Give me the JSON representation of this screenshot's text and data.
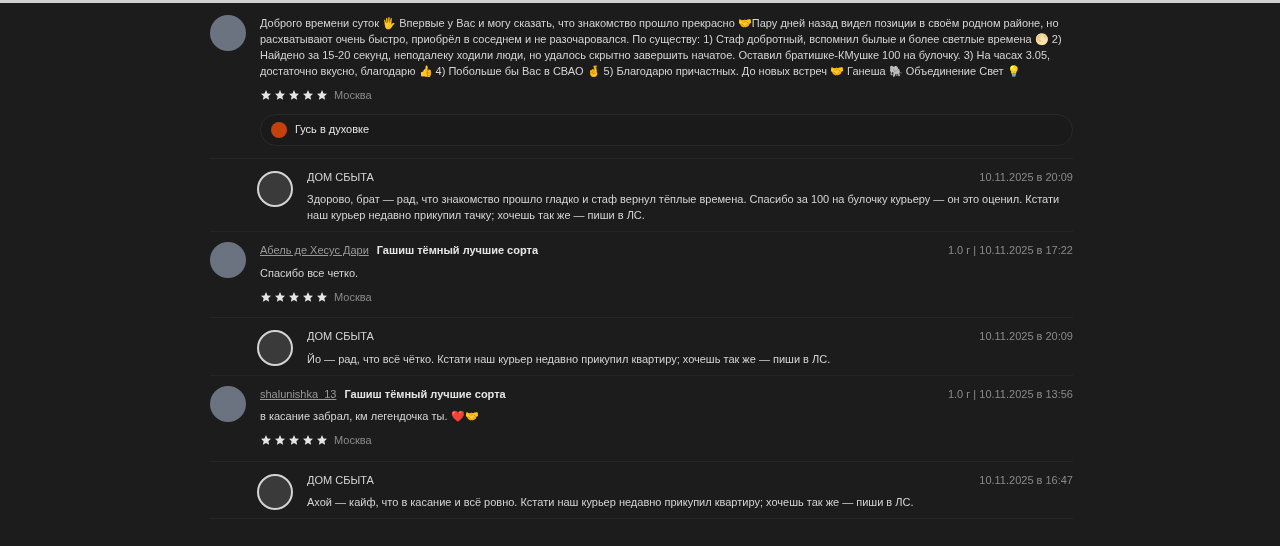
{
  "reviews": [
    {
      "text": "Доброго времени суток 🖐 Впервые у Вас и могу сказать, что знакомство прошло прекрасно 🤝Пару дней назад видел позиции в своём родном районе, но расхватывают очень быстро, приобрёл в соседнем и не разочаровался. По существу: 1) Стаф добротный, вспомнил былые и более светлые времена 🌕 2) Найдено за 15-20 секунд, неподалеку ходили люди, но удалось скрытно завершить начатое. Оставил братишке-КМушке 100 на булочку. 3) На часах 3.05, достаточно вкусно, благодарю 👍 4) Побольше бы Вас в СВАО 🤞 5) Благодарю причастных. До новых встреч 🤝 Ганеша 🐘 Объединение Свет 💡",
      "stars": 5,
      "city": "Москва",
      "tag": "Гусь в духовке",
      "reply": {
        "author": "ДОМ СБЫТА",
        "date": "10.11.2025 в 20:09",
        "text": "Здорово, брат — рад, что знакомство прошло гладко и стаф вернул тёплые времена. Спасибо за 100 на булочку курьеру — он это оценил. Кстати наш курьер недавно прикупил тачку; хочешь так же — пиши в ЛС."
      }
    },
    {
      "author": "Абель де Хесус Дари",
      "product": "Гашиш тёмный лучшие сорта",
      "meta": "1.0 г | 10.11.2025 в 17:22",
      "text": "Спасибо все четко.",
      "stars": 5,
      "city": "Москва",
      "reply": {
        "author": "ДОМ СБЫТА",
        "date": "10.11.2025 в 20:09",
        "text": "Йо — рад, что всё чётко. Кстати наш курьер недавно прикупил квартиру; хочешь так же — пиши в ЛС."
      }
    },
    {
      "author": "shalunishka_13",
      "product": "Гашиш тёмный лучшие сорта",
      "meta": "1.0 г | 10.11.2025 в 13:56",
      "text": "в касание забрал, км легендочка ты. ❤️🤝",
      "stars": 5,
      "city": "Москва",
      "reply": {
        "author": "ДОМ СБЫТА",
        "date": "10.11.2025 в 16:47",
        "text": "Ахой — кайф, что в касание и всё ровно. Кстати наш курьер недавно прикупил квартиру; хочешь так же — пиши в ЛС."
      }
    }
  ]
}
